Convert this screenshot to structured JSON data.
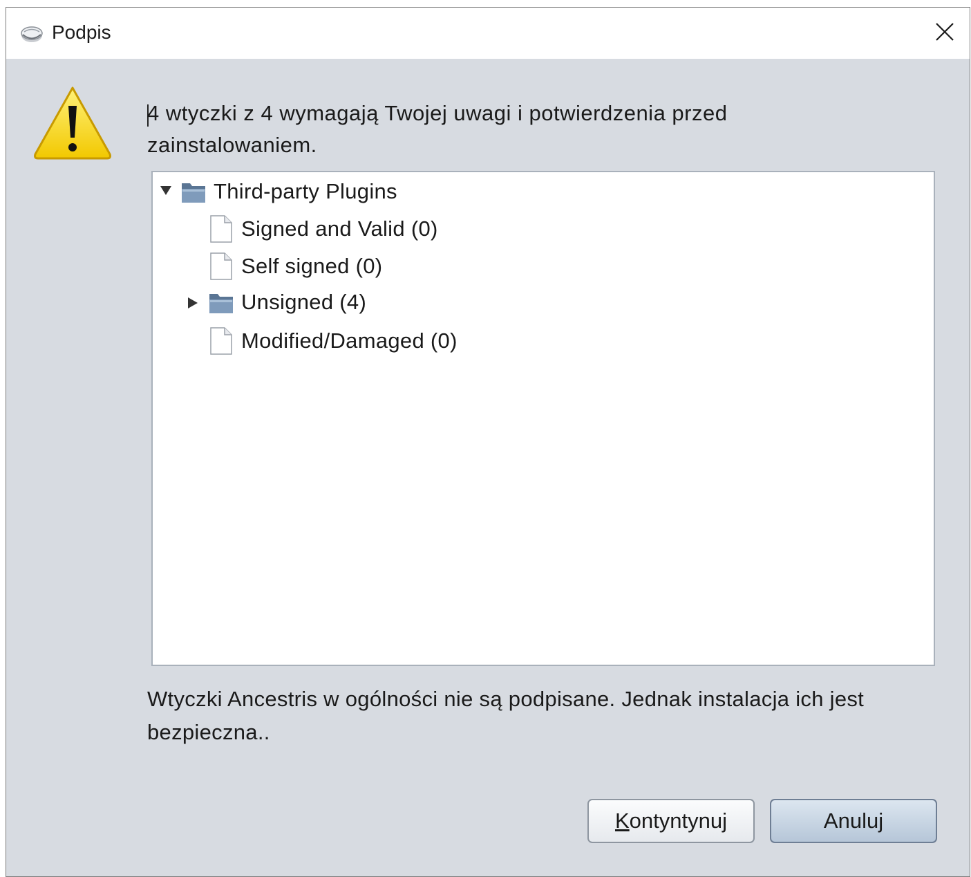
{
  "window": {
    "title": "Podpis"
  },
  "dialog": {
    "message": "4 wtyczki z 4 wymagają Twojej uwagi i potwierdzenia przed zainstalowaniem.",
    "note": "Wtyczki Ancestris w ogólności nie są podpisane. Jednak instalacja ich jest bezpieczna..",
    "icon": "warning-icon"
  },
  "tree": {
    "root": {
      "label": "Third-party Plugins",
      "expanded": true
    },
    "children": [
      {
        "label": "Signed and Valid (0)",
        "kind": "file"
      },
      {
        "label": "Self signed (0)",
        "kind": "file"
      },
      {
        "label": "Unsigned (4)",
        "kind": "folder",
        "expanded": false
      },
      {
        "label": "Modified/Damaged (0)",
        "kind": "file"
      }
    ]
  },
  "buttons": {
    "continue_mnemonic": "K",
    "continue_rest": "ontyntynuj",
    "cancel": "Anuluj"
  },
  "colors": {
    "dialog_bg": "#d7dbe1",
    "warning_yellow": "#f5d800",
    "folder_blue": "#6f8aa8"
  }
}
